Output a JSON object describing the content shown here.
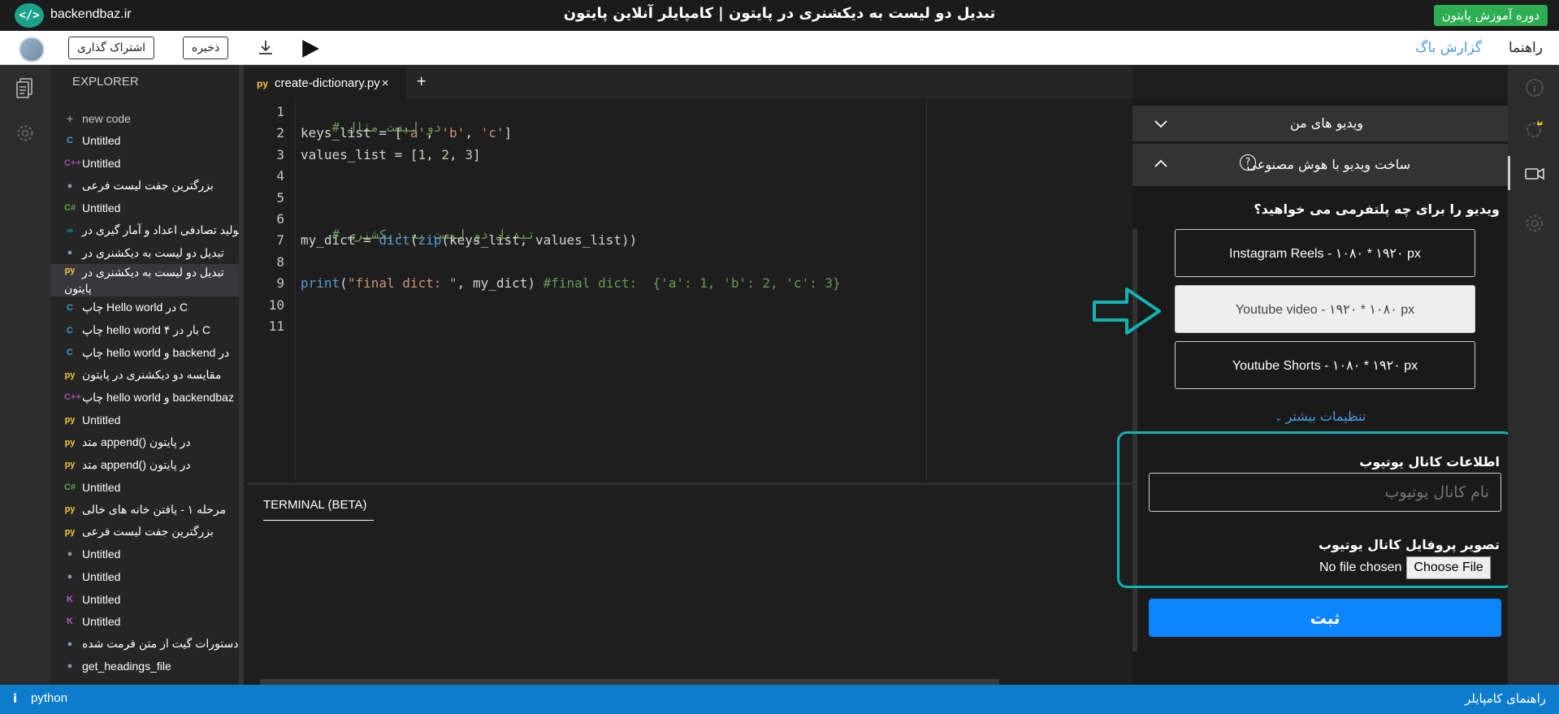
{
  "topbar": {
    "logo_glyph": "</>",
    "site_name": "backendbaz.ir",
    "page_title": "تبدیل دو لیست به دیکشنری در پایتون | کامپایلر آنلاین پایتون",
    "course_button": "دوره آموزش پایتون"
  },
  "toolbar": {
    "share_label": "اشتراک گذاری",
    "save_label": "ذخیره",
    "report_bug": "گزارش باگ",
    "guide": "راهنما"
  },
  "explorer": {
    "title": "EXPLORER",
    "new_code": "new code",
    "items": [
      {
        "icon": "C",
        "color": "#3b9dd8",
        "label": "Untitled"
      },
      {
        "icon": "C++",
        "color": "#a0519e",
        "label": "Untitled"
      },
      {
        "icon": "●",
        "color": "#7aa0c8",
        "label": "بزرگترین جفت لیست فرعی"
      },
      {
        "icon": "C#",
        "color": "#5fa545",
        "label": "Untitled"
      },
      {
        "icon": "∞",
        "color": "#00a0b0",
        "label": "تولید تصادفی اعداد و آمار گیری در"
      },
      {
        "icon": "●",
        "color": "#7aa0c8",
        "label": "تبدیل دو لیست به دیکشنری در"
      },
      {
        "icon": "py",
        "color": "#f2c93a",
        "label": "تبدیل دو لیست به دیکشنری در",
        "label2": "پایتون",
        "active": true
      },
      {
        "icon": "C",
        "color": "#3b9dd8",
        "label": "چاپ Hello world در C"
      },
      {
        "icon": "C",
        "color": "#3b9dd8",
        "label": "چاپ hello world ۴ بار در C"
      },
      {
        "icon": "C",
        "color": "#3b9dd8",
        "label": "چاپ hello world و backend در"
      },
      {
        "icon": "py",
        "color": "#f2c93a",
        "label": "مقایسه دو دیکشنری در پایتون"
      },
      {
        "icon": "C++",
        "color": "#a0519e",
        "label": "چاپ hello world و backendbaz"
      },
      {
        "icon": "py",
        "color": "#f2c93a",
        "label": "Untitled"
      },
      {
        "icon": "py",
        "color": "#f2c93a",
        "label": "متد append() در پایتون"
      },
      {
        "icon": "py",
        "color": "#f2c93a",
        "label": "متد append() در پایتون"
      },
      {
        "icon": "C#",
        "color": "#5fa545",
        "label": "Untitled"
      },
      {
        "icon": "py",
        "color": "#f2c93a",
        "label": "مرحله ۱ - یافتن خانه های خالی"
      },
      {
        "icon": "py",
        "color": "#f2c93a",
        "label": "بزرگترین جفت لیست فرعی"
      },
      {
        "icon": "●",
        "color": "#7aa0c8",
        "label": "Untitled"
      },
      {
        "icon": "●",
        "color": "#7aa0c8",
        "label": "Untitled"
      },
      {
        "icon": "K",
        "color": "#b05cc8",
        "label": "Untitled"
      },
      {
        "icon": "K",
        "color": "#b05cc8",
        "label": "Untitled"
      },
      {
        "icon": "●",
        "color": "#7aa0c8",
        "label": "دستورات گیت از متن فرمت شده"
      },
      {
        "icon": "●",
        "color": "#7aa0c8",
        "label": "get_headings_file"
      }
    ]
  },
  "editor": {
    "tab_name": "create-dictionary.py",
    "tab_close": "×",
    "tab_add": "+",
    "line_numbers": [
      "1",
      "2",
      "3",
      "4",
      "5",
      "6",
      "7",
      "8",
      "9",
      "10",
      "11"
    ],
    "code": {
      "l1": "# دو لیست مثال",
      "l2a": "keys_list = [",
      "l2b": "'a'",
      "l2c": ", ",
      "l2d": "'b'",
      "l2e": ", ",
      "l2f": "'c'",
      "l2g": "]",
      "l3a": "values_list = [",
      "l3b": "1",
      "l3c": ", ",
      "l3d": "2",
      "l3e": ", ",
      "l3f": "3",
      "l3g": "]",
      "l6": "# تبدیل دو لیست به دیکشنری",
      "l7a": "my_dict = ",
      "l7b": "dict",
      "l7c": "(",
      "l7d": "zip",
      "l7e": "(keys_list, values_list))",
      "l9a": "print",
      "l9b": "(",
      "l9c": "\"final dict: \"",
      "l9d": ", my_dict) ",
      "l9e": "#final dict:  {'a': 1, 'b': 2, 'c': 3}"
    }
  },
  "terminal": {
    "tab_label": "TERMINAL (BETA)"
  },
  "right_panel": {
    "my_videos": "ویدیو های من",
    "ai_video": "ساخت ویدیو با هوش مصنوعی",
    "help_glyph": "?",
    "platform_question": "ویدیو را برای چه پلتفرمی می خواهید؟",
    "platforms": [
      {
        "label": "Instagram Reels - ۱۰۸۰ * ۱۹۲۰ px",
        "selected": false
      },
      {
        "label": "Youtube video - ۱۹۲۰ * ۱۰۸۰ px",
        "selected": true
      },
      {
        "label": "Youtube Shorts - ۱۰۸۰ * ۱۹۲۰ px",
        "selected": false
      }
    ],
    "more_settings": "تنظیمات بیشتر",
    "channel_info_label": "اطلاعات کانال یوتیوب",
    "channel_name_placeholder": "نام کانال یوتیوب",
    "profile_image_label": "تصویر پروفایل کانال یوتیوب",
    "no_file": "No file chosen",
    "choose_file": "Choose File",
    "submit": "ثبت"
  },
  "statusbar": {
    "info_glyph": "i",
    "language": "python",
    "compiler_guide": "راهنمای کامپایلر"
  },
  "colors": {
    "accent_blue": "#0b86ff",
    "status_blue": "#0e7ccc",
    "course_green": "#2eae52",
    "annotation_teal": "#11b3b3"
  }
}
